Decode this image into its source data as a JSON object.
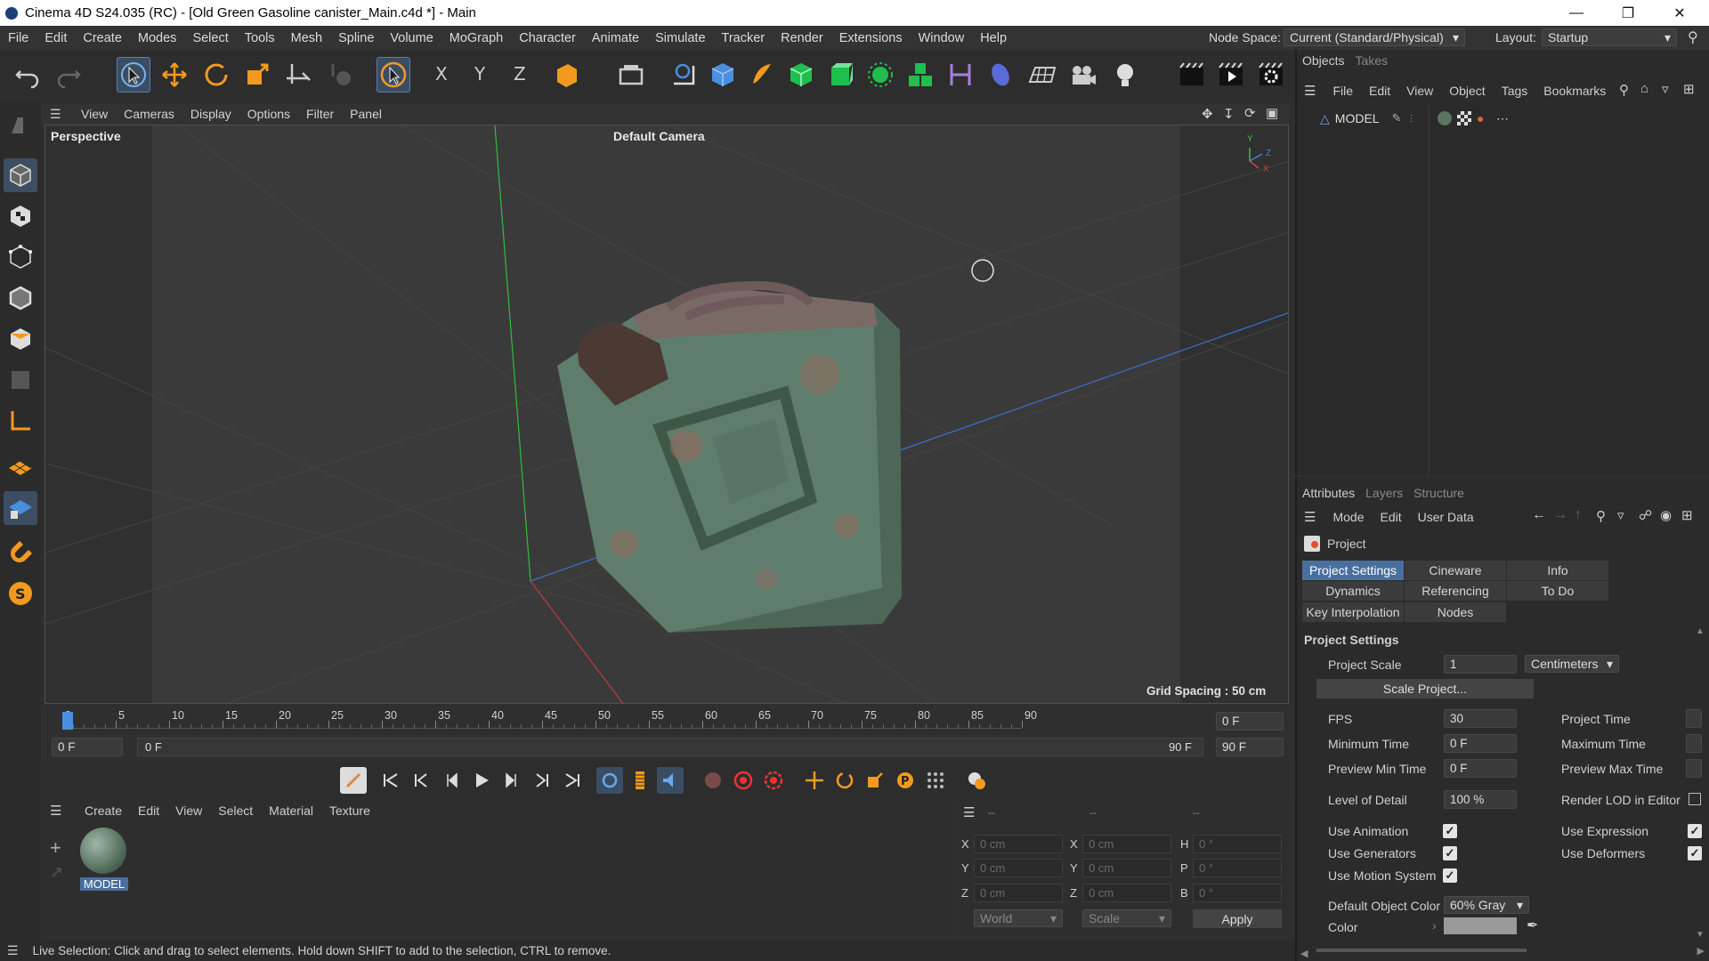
{
  "window": {
    "title": "Cinema 4D S24.035 (RC) - [Old Green Gasoline canister_Main.c4d *] - Main"
  },
  "menubar": {
    "items": [
      "File",
      "Edit",
      "Create",
      "Modes",
      "Select",
      "Tools",
      "Mesh",
      "Spline",
      "Volume",
      "MoGraph",
      "Character",
      "Animate",
      "Simulate",
      "Tracker",
      "Render",
      "Extensions",
      "Window",
      "Help"
    ],
    "node_space_label": "Node Space:",
    "node_space_value": "Current (Standard/Physical)",
    "layout_label": "Layout:",
    "layout_value": "Startup"
  },
  "viewport": {
    "menu": [
      "View",
      "Cameras",
      "Display",
      "Options",
      "Filter",
      "Panel"
    ],
    "projection": "Perspective",
    "camera": "Default Camera",
    "grid_spacing": "Grid Spacing : 50 cm",
    "axis_y": "Y",
    "axis_z": "Z",
    "axis_x": "X"
  },
  "timeline": {
    "ticks": [
      "0",
      "5",
      "10",
      "15",
      "20",
      "25",
      "30",
      "35",
      "40",
      "45",
      "50",
      "55",
      "60",
      "65",
      "70",
      "75",
      "80",
      "85",
      "90"
    ],
    "current_frame": "0 F",
    "start_frame": "0 F",
    "range_start": "0 F",
    "range_end": "90 F",
    "end_frame": "90 F"
  },
  "material_manager": {
    "menu": [
      "Create",
      "Edit",
      "View",
      "Select",
      "Material",
      "Texture"
    ],
    "material_name": "MODEL"
  },
  "coordinates": {
    "header": [
      "--",
      "--",
      "--"
    ],
    "rows": [
      {
        "a": "X",
        "av": "0 cm",
        "b": "X",
        "bv": "0 cm",
        "c": "H",
        "cv": "0 °"
      },
      {
        "a": "Y",
        "av": "0 cm",
        "b": "Y",
        "bv": "0 cm",
        "c": "P",
        "cv": "0 °"
      },
      {
        "a": "Z",
        "av": "0 cm",
        "b": "Z",
        "bv": "0 cm",
        "c": "B",
        "cv": "0 °"
      }
    ],
    "mode": "World",
    "scale": "Scale",
    "apply": "Apply"
  },
  "status": "Live Selection: Click and drag to select elements. Hold down SHIFT to add to the selection, CTRL to remove.",
  "objects_panel": {
    "tabs": [
      "Objects",
      "Takes"
    ],
    "menu": [
      "File",
      "Edit",
      "View",
      "Object",
      "Tags",
      "Bookmarks"
    ],
    "object_name": "MODEL"
  },
  "attributes": {
    "tabs": [
      "Attributes",
      "Layers",
      "Structure"
    ],
    "menu": [
      "Mode",
      "Edit",
      "User Data"
    ],
    "object": "Project",
    "subtabs": [
      "Project Settings",
      "Cineware",
      "Info",
      "Dynamics",
      "Referencing",
      "To Do",
      "Key Interpolation",
      "Nodes"
    ],
    "section": "Project Settings",
    "project_scale_label": "Project Scale",
    "project_scale_value": "1",
    "project_scale_unit": "Centimeters",
    "scale_project_btn": "Scale Project...",
    "fps_label": "FPS",
    "fps_value": "30",
    "project_time_label": "Project Time",
    "min_time_label": "Minimum Time",
    "min_time_value": "0 F",
    "max_time_label": "Maximum Time",
    "prev_min_label": "Preview Min Time",
    "prev_min_value": "0 F",
    "prev_max_label": "Preview Max Time",
    "lod_label": "Level of Detail",
    "lod_value": "100 %",
    "render_lod_label": "Render LOD in Editor",
    "use_animation": "Use Animation",
    "use_expression": "Use Expression",
    "use_generators": "Use Generators",
    "use_deformers": "Use Deformers",
    "use_motion": "Use Motion System",
    "default_color_label": "Default Object Color",
    "default_color_value": "60% Gray",
    "color_label": "Color"
  },
  "colors": {
    "accent": "#4a6f9e",
    "panel": "#2b2b2b",
    "viewport": "#393939"
  }
}
